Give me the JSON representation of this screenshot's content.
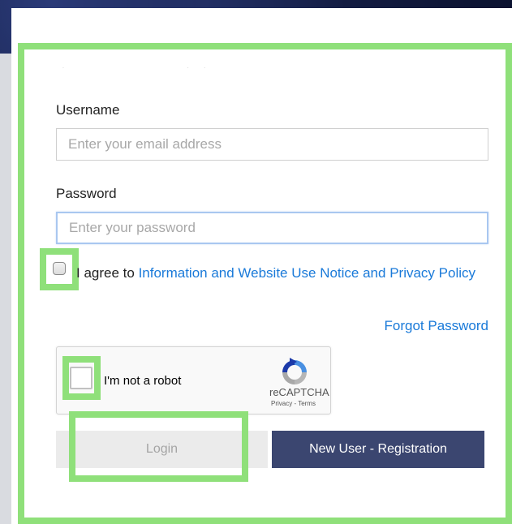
{
  "form": {
    "username_label": "Username",
    "username_placeholder": "Enter your email address",
    "password_label": "Password",
    "password_placeholder": "Enter your password",
    "agree_prefix": "I agree to ",
    "agree_link": "Information and Website Use Notice and Privacy Policy",
    "forgot_password": "Forgot Password",
    "login_button": "Login",
    "register_button": "New User - Registration"
  },
  "recaptcha": {
    "label": "I'm not a robot",
    "brand": "reCAPTCHA",
    "terms": "Privacy - Terms"
  },
  "colors": {
    "highlight": "#8fe07a",
    "link": "#1a7ad9",
    "register_button_bg": "#3b4670",
    "login_button_bg": "#ebebeb"
  }
}
